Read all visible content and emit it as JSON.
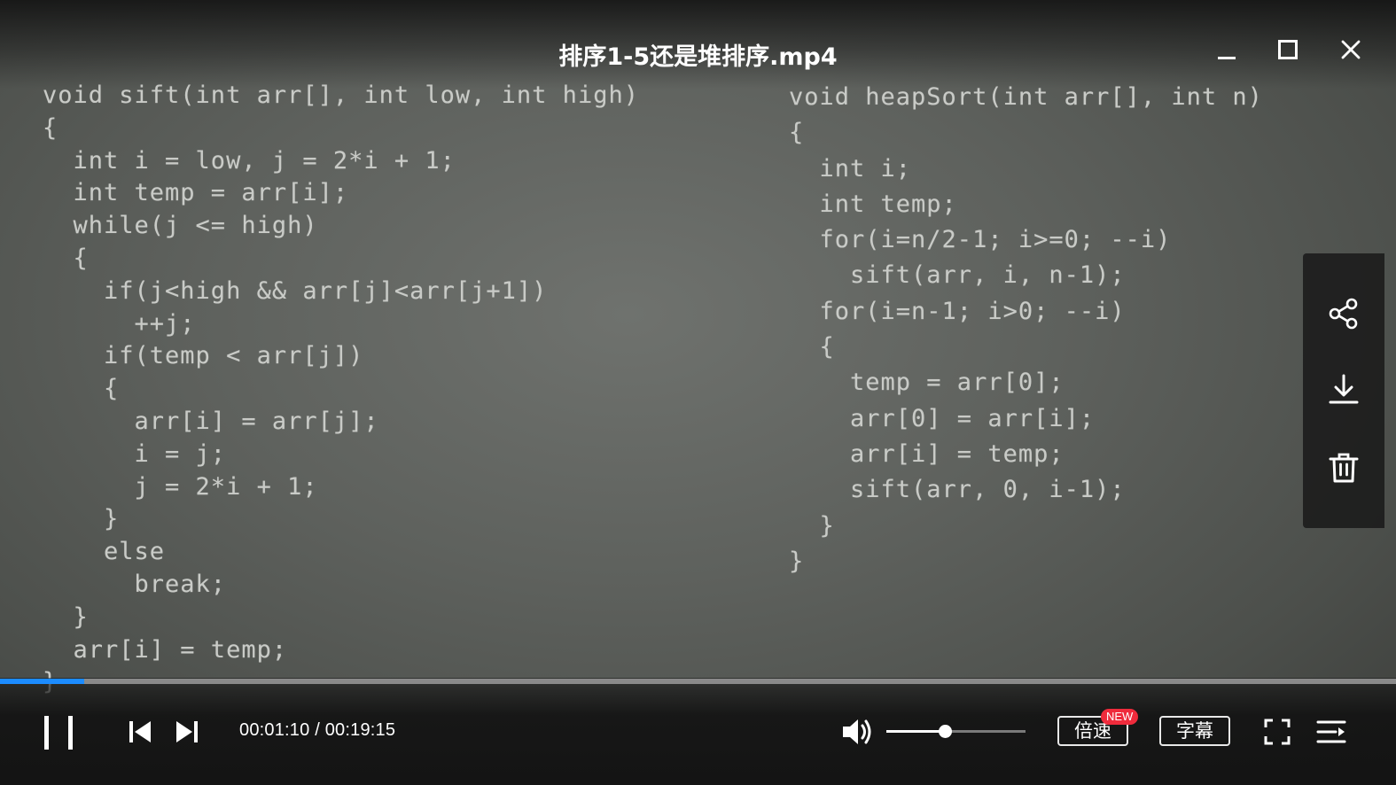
{
  "window": {
    "title": "排序1-5还是堆排序.mp4"
  },
  "video": {
    "code_left": [
      "void sift(int arr[], int low, int high)",
      "{",
      "  int i = low, j = 2*i + 1;",
      "  int temp = arr[i];",
      "  while(j <= high)",
      "  {",
      "    if(j<high && arr[j]<arr[j+1])",
      "      ++j;",
      "    if(temp < arr[j])",
      "    {",
      "      arr[i] = arr[j];",
      "      i = j;",
      "      j = 2*i + 1;",
      "    }",
      "    else",
      "      break;",
      "  }",
      "  arr[i] = temp;",
      "}"
    ],
    "code_right": [
      "void heapSort(int arr[], int n)",
      "{",
      "  int i;",
      "  int temp;",
      "  for(i=n/2-1; i>=0; --i)",
      "    sift(arr, i, n-1);",
      "  for(i=n-1; i>0; --i)",
      "  {",
      "    temp = arr[0];",
      "    arr[0] = arr[i];",
      "    arr[i] = temp;",
      "    sift(arr, 0, i-1);",
      "  }",
      "}"
    ]
  },
  "side_panel": {
    "icons": [
      "share-icon",
      "download-icon",
      "trash-icon"
    ]
  },
  "controls": {
    "current_time": "00:01:10",
    "separator": " / ",
    "total_time": "00:19:15",
    "progress_fraction": 0.0606,
    "volume_fraction": 0.42,
    "speed_label": "倍速",
    "new_badge": "NEW",
    "subtitle_label": "字幕"
  },
  "colors": {
    "progress": "#1c8cff",
    "badge": "#ef2b3c",
    "code_text": "#c9cbc7"
  }
}
